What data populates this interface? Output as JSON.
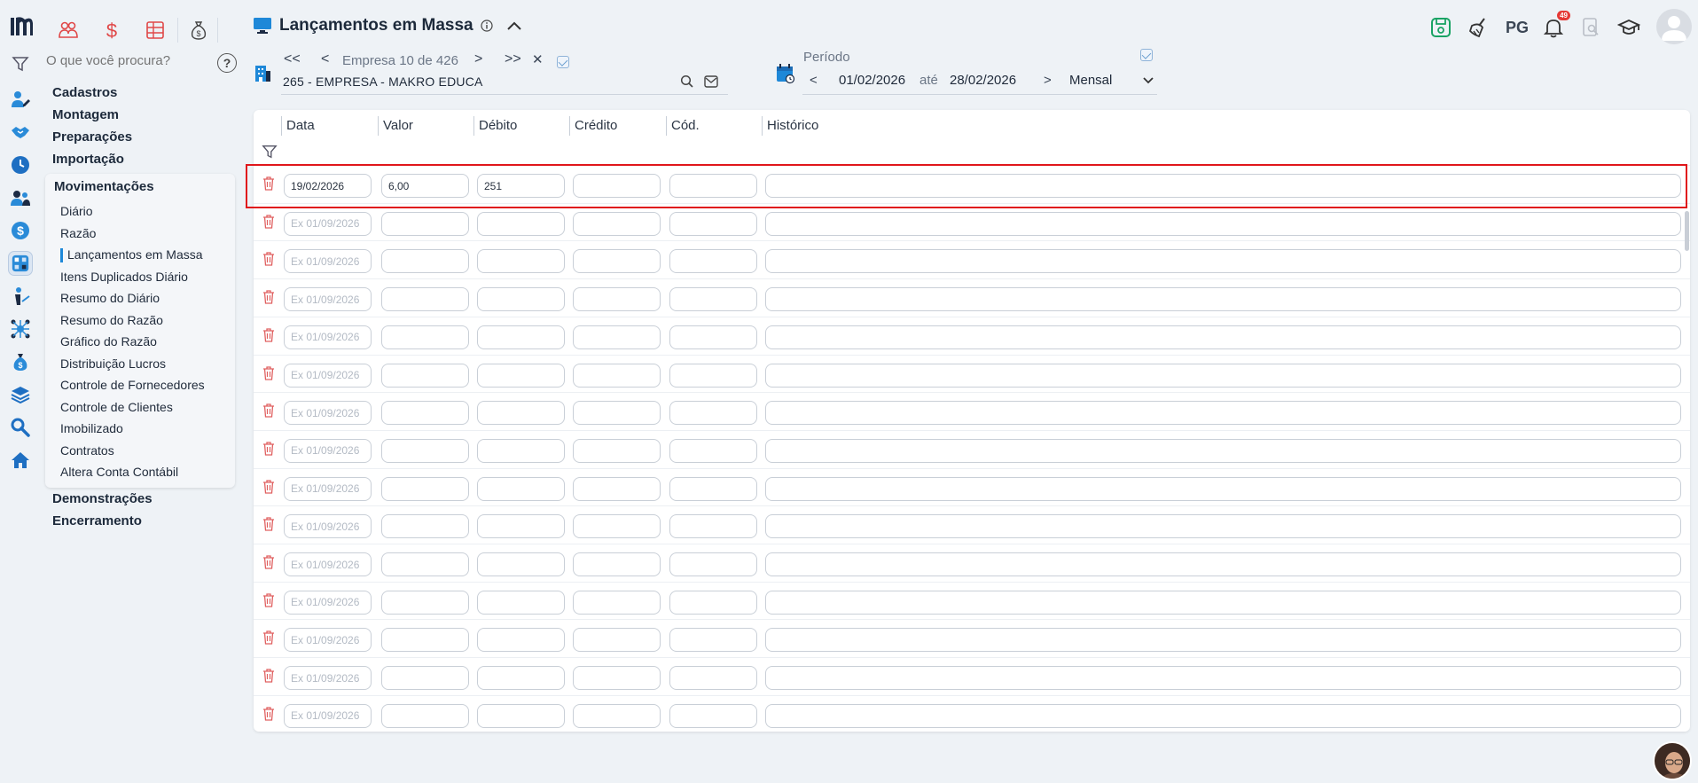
{
  "quick_icons": [
    "people-icon",
    "dollar-icon",
    "spreadsheet-icon",
    "money-bag-icon"
  ],
  "rail_icons": [
    "user-edit-icon",
    "handshake-icon",
    "clock-icon",
    "users-icon",
    "dollar-circle-icon",
    "calculator-icon",
    "hand-coin-icon",
    "network-icon",
    "money-bag-icon",
    "layers-icon",
    "search-icon",
    "home-icon"
  ],
  "sidebar": {
    "search_placeholder": "O que você procura?",
    "help_label": "?",
    "sections": [
      "Cadastros",
      "Montagem",
      "Preparações",
      "Importação"
    ],
    "open_section": "Movimentações",
    "items": [
      "Diário",
      "Razão",
      "Lançamentos em Massa",
      "Itens Duplicados Diário",
      "Resumo do Diário",
      "Resumo do Razão",
      "Gráfico do Razão",
      "Distribuição Lucros",
      "Controle de Fornecedores",
      "Controle de Clientes",
      "Imobilizado",
      "Contratos",
      "Altera Conta Contábil"
    ],
    "active_item": "Lançamentos em Massa",
    "sections_after": [
      "Demonstrações",
      "Encerramento"
    ]
  },
  "header": {
    "title": "Lançamentos em Massa",
    "user_initials": "PG",
    "notification_count": "49"
  },
  "company": {
    "first_label": "<<",
    "prev_label": "<",
    "counter_label": "Empresa 10 de 426",
    "next_label": ">",
    "last_label": ">>",
    "clear_label": "✕",
    "name": "265 - EMPRESA - MAKRO EDUCA"
  },
  "period": {
    "label": "Período",
    "prev_label": "<",
    "start": "01/02/2026",
    "separator": "até",
    "end": "28/02/2026",
    "next_label": ">",
    "mode": "Mensal"
  },
  "grid": {
    "columns": [
      "Data",
      "Valor",
      "Débito",
      "Crédito",
      "Cód.",
      "Histórico"
    ],
    "date_placeholder": "Ex 01/09/2026",
    "rows": [
      {
        "data": "19/02/2026",
        "valor": "6,00",
        "debito": "251",
        "credito": "",
        "cod": "",
        "historico": ""
      },
      {
        "data": "",
        "valor": "",
        "debito": "",
        "credito": "",
        "cod": "",
        "historico": ""
      },
      {
        "data": "",
        "valor": "",
        "debito": "",
        "credito": "",
        "cod": "",
        "historico": ""
      },
      {
        "data": "",
        "valor": "",
        "debito": "",
        "credito": "",
        "cod": "",
        "historico": ""
      },
      {
        "data": "",
        "valor": "",
        "debito": "",
        "credito": "",
        "cod": "",
        "historico": ""
      },
      {
        "data": "",
        "valor": "",
        "debito": "",
        "credito": "",
        "cod": "",
        "historico": ""
      },
      {
        "data": "",
        "valor": "",
        "debito": "",
        "credito": "",
        "cod": "",
        "historico": ""
      },
      {
        "data": "",
        "valor": "",
        "debito": "",
        "credito": "",
        "cod": "",
        "historico": ""
      },
      {
        "data": "",
        "valor": "",
        "debito": "",
        "credito": "",
        "cod": "",
        "historico": ""
      },
      {
        "data": "",
        "valor": "",
        "debito": "",
        "credito": "",
        "cod": "",
        "historico": ""
      },
      {
        "data": "",
        "valor": "",
        "debito": "",
        "credito": "",
        "cod": "",
        "historico": ""
      },
      {
        "data": "",
        "valor": "",
        "debito": "",
        "credito": "",
        "cod": "",
        "historico": ""
      },
      {
        "data": "",
        "valor": "",
        "debito": "",
        "credito": "",
        "cod": "",
        "historico": ""
      },
      {
        "data": "",
        "valor": "",
        "debito": "",
        "credito": "",
        "cod": "",
        "historico": ""
      },
      {
        "data": "",
        "valor": "",
        "debito": "",
        "credito": "",
        "cod": "",
        "historico": ""
      }
    ]
  },
  "colors": {
    "accent_blue": "#1e88d8",
    "danger_red": "#e0161b",
    "save_green": "#1aa364"
  }
}
